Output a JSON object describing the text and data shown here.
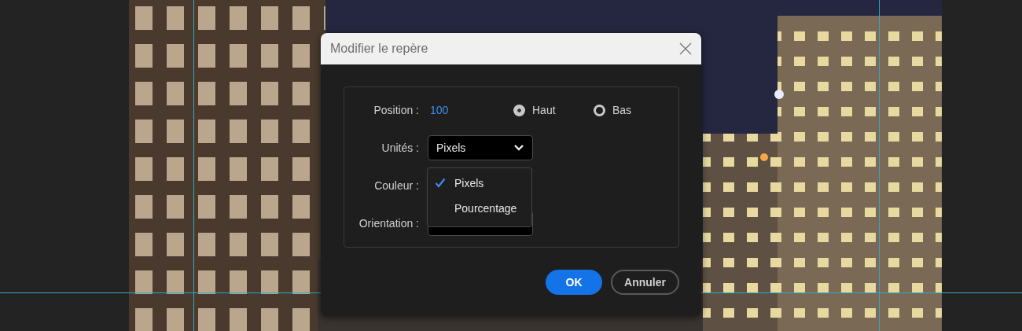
{
  "dialog": {
    "title": "Modifier le repère",
    "position": {
      "label": "Position :",
      "value": "100",
      "options": [
        {
          "label": "Haut",
          "selected": true
        },
        {
          "label": "Bas",
          "selected": false
        }
      ]
    },
    "units": {
      "label": "Unités :",
      "value": "Pixels"
    },
    "color": {
      "label": "Couleur :"
    },
    "orientation": {
      "label": "Orientation :"
    },
    "menu": {
      "items": [
        {
          "label": "Pixels",
          "checked": true
        },
        {
          "label": "Pourcentage",
          "checked": false
        }
      ]
    },
    "buttons": [
      {
        "label": "OK",
        "kind": "primary"
      },
      {
        "label": "Annuler",
        "kind": "secondary"
      }
    ]
  }
}
